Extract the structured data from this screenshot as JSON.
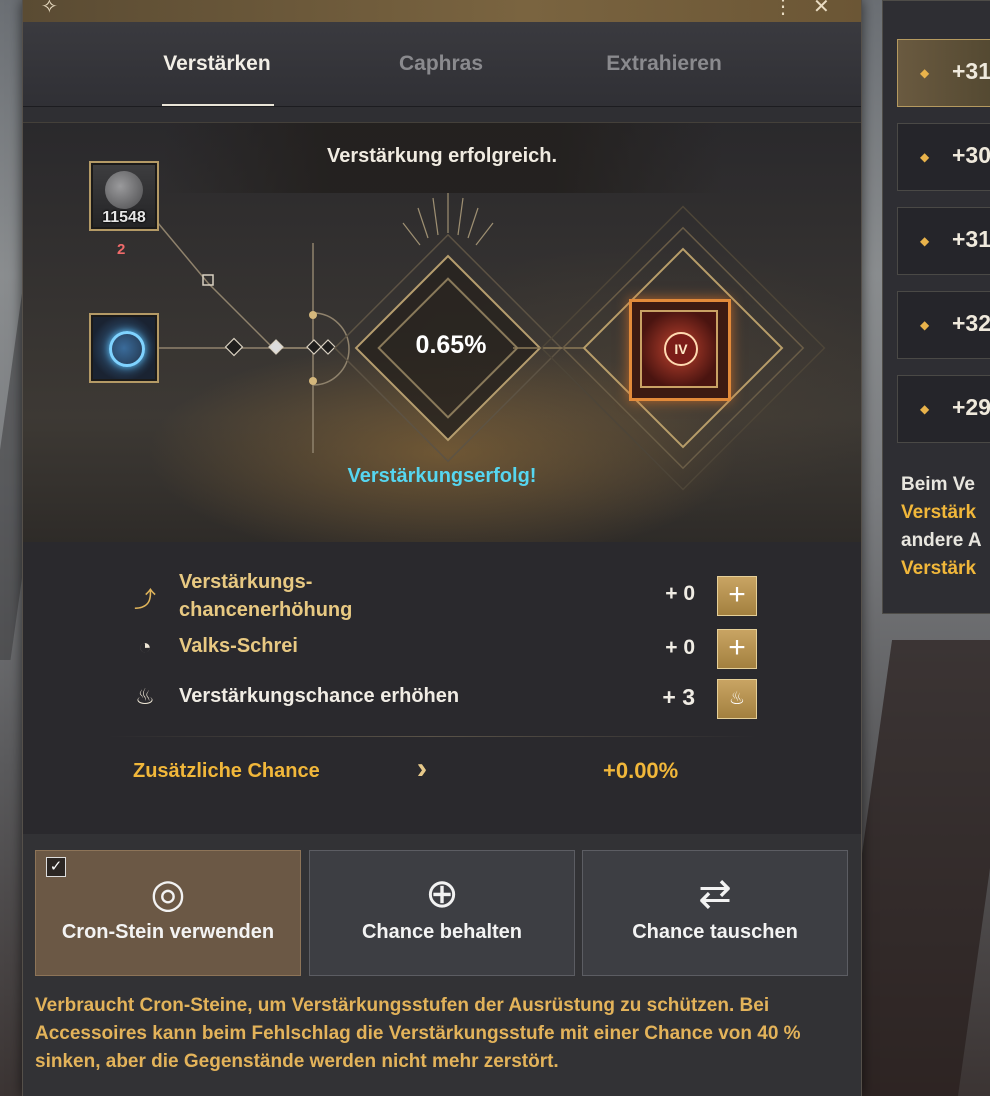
{
  "tabs": [
    {
      "label": "Verstärken",
      "active": true
    },
    {
      "label": "Caphras",
      "active": false
    },
    {
      "label": "Extrahieren",
      "active": false
    }
  ],
  "scene": {
    "message": "Verstärkung erfolgreich.",
    "material_count": "11548",
    "material_sub": "2",
    "rate": "0.65%",
    "result_badge": "IV",
    "success_message": "Verstärkungserfolg!"
  },
  "stats": [
    {
      "icon": "arrow-up-icon",
      "label_line1": "Verstärkungs-",
      "label_line2": "chancenerhöhung",
      "value": "+ 0"
    },
    {
      "icon": "valks-icon",
      "label": "Valks-Schrei",
      "value": "+ 0"
    },
    {
      "icon": "flame-icon",
      "label": "Verstärkungschance erhöhen",
      "value": "+ 3"
    }
  ],
  "extra": {
    "label": "Zusätzliche Chance",
    "value": "+0.00%"
  },
  "options": [
    {
      "label": "Cron-Stein verwenden",
      "checked": true
    },
    {
      "label": "Chance behalten"
    },
    {
      "label": "Chance tauschen"
    }
  ],
  "description": "Verbraucht Cron-Steine, um Verstärkungsstufen der Ausrüstung zu schützen. Bei Accessoires kann beim Fehlschlag die Verstärkungsstufe mit einer Chance von 40 % sinken, aber die Gegenstände werden nicht mehr zerstört.",
  "side": {
    "items": [
      "+31",
      "+30",
      "+31",
      "+32",
      "+29"
    ],
    "desc_lines": [
      "Beim Ve",
      "Verstärk",
      "andere A",
      "Verstärk"
    ]
  },
  "colors": {
    "accent_gold": "#f1b73a",
    "success_cyan": "#56d6f0",
    "count_red": "#f06a6a"
  }
}
